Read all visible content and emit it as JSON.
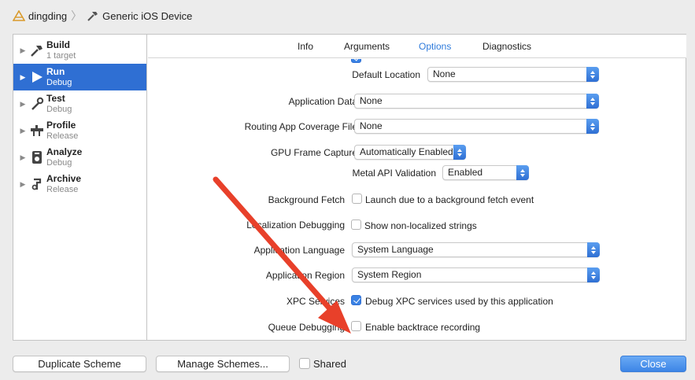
{
  "breadcrumb": {
    "project": "dingding",
    "device": "Generic iOS Device"
  },
  "sidebar": {
    "items": [
      {
        "name": "Build",
        "sub": "1 target",
        "icon": "hammer-icon",
        "selected": false
      },
      {
        "name": "Run",
        "sub": "Debug",
        "icon": "play-icon",
        "selected": true
      },
      {
        "name": "Test",
        "sub": "Debug",
        "icon": "wrench-icon",
        "selected": false
      },
      {
        "name": "Profile",
        "sub": "Release",
        "icon": "instruments-icon",
        "selected": false
      },
      {
        "name": "Analyze",
        "sub": "Debug",
        "icon": "analyze-icon",
        "selected": false
      },
      {
        "name": "Archive",
        "sub": "Release",
        "icon": "archive-icon",
        "selected": false
      }
    ]
  },
  "tabs": {
    "info": "Info",
    "arguments": "Arguments",
    "options": "Options",
    "diagnostics": "Diagnostics",
    "active": "Options"
  },
  "options": {
    "default_location": {
      "label": "Default Location",
      "value": "None"
    },
    "application_data": {
      "label": "Application Data",
      "value": "None"
    },
    "routing_coverage": {
      "label": "Routing App Coverage File",
      "value": "None"
    },
    "gpu_frame_capture": {
      "label": "GPU Frame Capture",
      "value": "Automatically Enabled"
    },
    "metal_api_validation": {
      "label": "Metal API Validation",
      "value": "Enabled"
    },
    "background_fetch": {
      "label": "Background Fetch",
      "checkbox": "Launch due to a background fetch event",
      "checked": false
    },
    "localization_debugging": {
      "label": "Localization Debugging",
      "checkbox": "Show non-localized strings",
      "checked": false
    },
    "application_language": {
      "label": "Application Language",
      "value": "System Language"
    },
    "application_region": {
      "label": "Application Region",
      "value": "System Region"
    },
    "xpc_services": {
      "label": "XPC Services",
      "checkbox": "Debug XPC services used by this application",
      "checked": true
    },
    "queue_debugging": {
      "label": "Queue Debugging",
      "checkbox": "Enable backtrace recording",
      "checked": false
    }
  },
  "footer": {
    "duplicate": "Duplicate Scheme",
    "manage": "Manage Schemes...",
    "shared": "Shared",
    "close": "Close"
  },
  "colors": {
    "accent": "#2f6fd3",
    "annotation_arrow": "#e8402a"
  }
}
